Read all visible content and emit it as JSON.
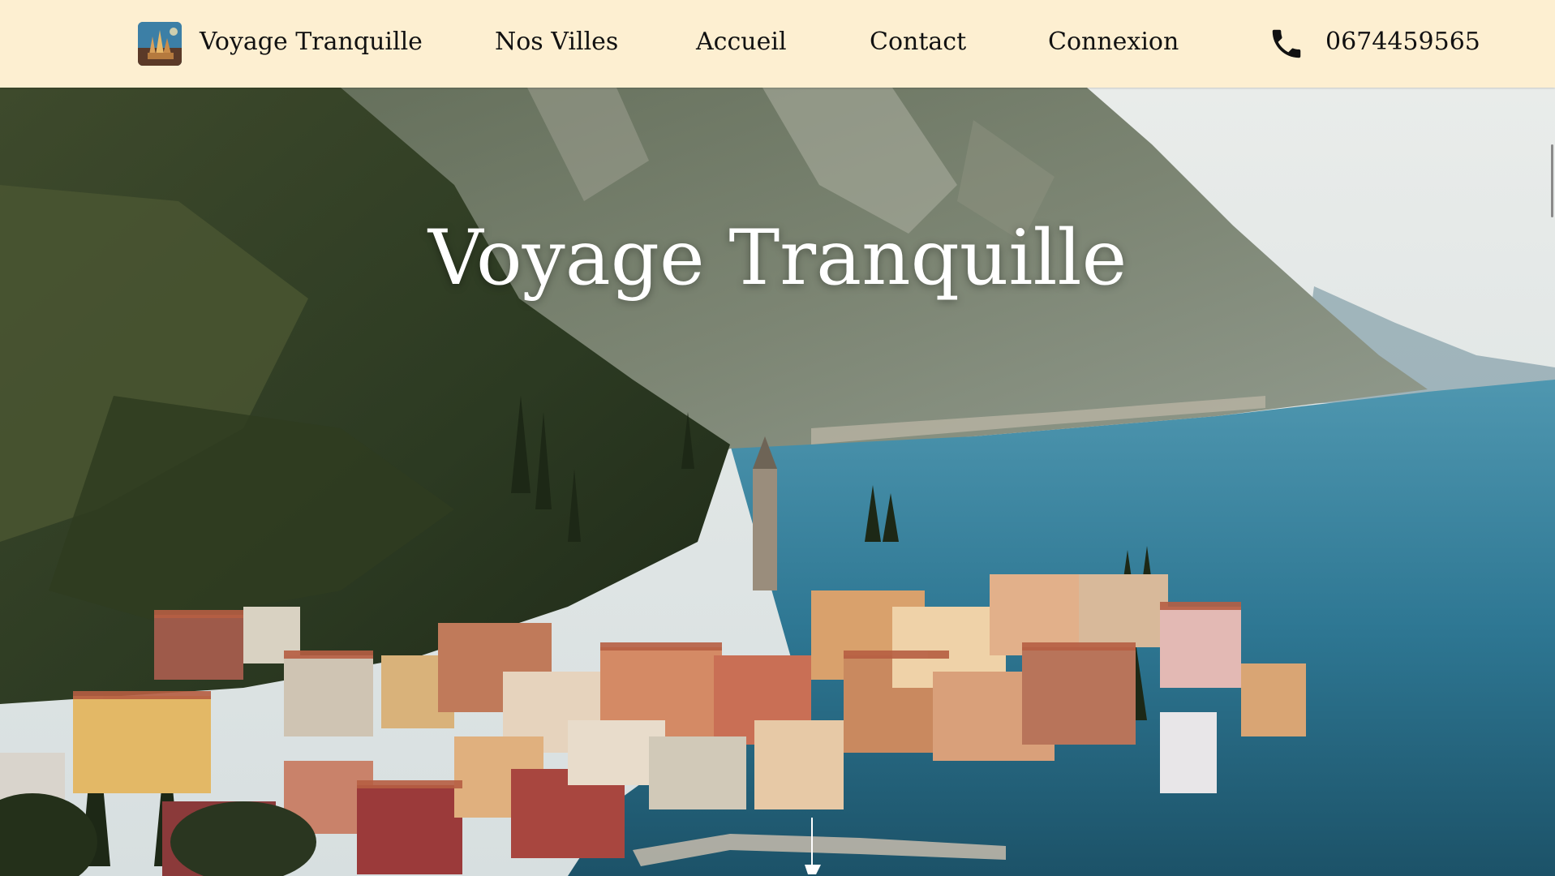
{
  "header": {
    "brand": "Voyage Tranquille",
    "logo_icon": "castle-logo-icon",
    "nav": [
      {
        "label": "Nos Villes"
      },
      {
        "label": "Accueil"
      },
      {
        "label": "Contact"
      },
      {
        "label": "Connexion"
      }
    ],
    "phone_icon": "phone-icon",
    "phone": "0674459565",
    "background_color": "#fdefd1"
  },
  "hero": {
    "title": "Voyage Tranquille",
    "image": "aerial-lakeside-village-photo"
  }
}
